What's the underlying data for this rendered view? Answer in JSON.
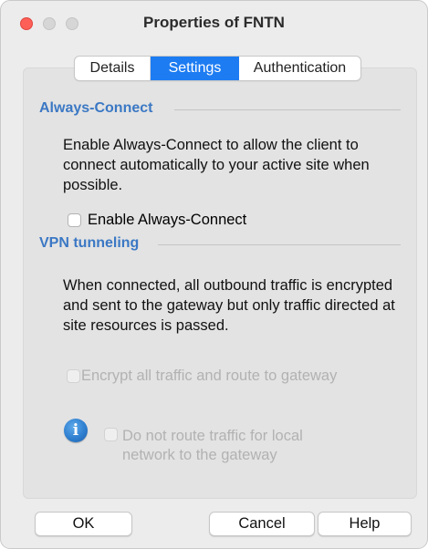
{
  "window": {
    "title": "Properties of FNTN"
  },
  "tabs": [
    {
      "label": "Details",
      "selected": false
    },
    {
      "label": "Settings",
      "selected": true
    },
    {
      "label": "Authentication",
      "selected": false
    }
  ],
  "always_connect": {
    "heading": "Always-Connect",
    "description": "Enable Always-Connect to allow the client to connect automatically to your active site when possible.",
    "checkbox_label": "Enable Always-Connect",
    "checked": false
  },
  "vpn_tunneling": {
    "heading": "VPN tunneling",
    "description": "When connected, all outbound traffic is encrypted and sent to the gateway but only traffic directed at site resources is passed.",
    "encrypt_label": "Encrypt all traffic and route to gateway",
    "encrypt_checked": false,
    "encrypt_enabled": false,
    "local_label": "Do not route traffic for local network to the gateway",
    "local_checked": false,
    "local_enabled": false,
    "info_icon": "info-icon"
  },
  "buttons": {
    "ok": "OK",
    "cancel": "Cancel",
    "help": "Help"
  },
  "colors": {
    "accent": "#1d7cf2",
    "section_heading": "#3b78c4",
    "close": "#fe5f57"
  }
}
